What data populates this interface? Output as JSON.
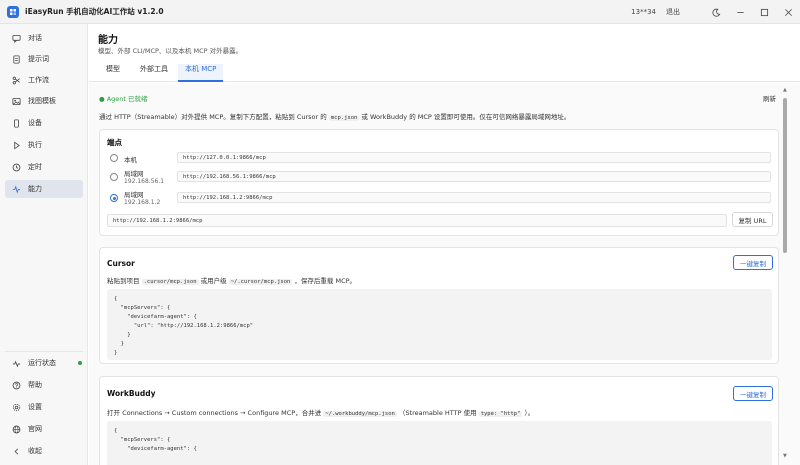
{
  "app": {
    "title": "iEasyRun 手机自动化AI工作站 v1.2.0",
    "user": "13**34",
    "logout": "退出"
  },
  "sidebar": {
    "items": [
      {
        "label": "对话",
        "icon": "chat-icon"
      },
      {
        "label": "提示词",
        "icon": "document-icon"
      },
      {
        "label": "工作流",
        "icon": "workflow-icon"
      },
      {
        "label": "找图模板",
        "icon": "image-icon"
      },
      {
        "label": "设备",
        "icon": "phone-icon"
      },
      {
        "label": "执行",
        "icon": "play-icon"
      },
      {
        "label": "定时",
        "icon": "clock-icon"
      },
      {
        "label": "能力",
        "icon": "capability-icon"
      }
    ],
    "bottom": [
      {
        "label": "运行状态",
        "icon": "pulse-icon"
      },
      {
        "label": "帮助",
        "icon": "help-icon"
      },
      {
        "label": "设置",
        "icon": "gear-icon"
      },
      {
        "label": "官网",
        "icon": "globe-icon"
      },
      {
        "label": "收起",
        "icon": "collapse-icon"
      }
    ]
  },
  "header": {
    "title": "能力",
    "subtitle": "模型、外部 CLI/MCP、以及本机 MCP 对外暴露。",
    "tabs": [
      {
        "label": "模型"
      },
      {
        "label": "外部工具"
      },
      {
        "label": "本机 MCP"
      }
    ]
  },
  "content": {
    "agent_status": "● Agent 已就绪",
    "refresh": "刷新",
    "desc_prefix": "通过 HTTP（Streamable）对外提供 MCP。复制下方配置，粘贴到 Cursor 的",
    "desc_code1": "mcp.json",
    "desc_mid": "或 WorkBuddy 的 MCP 设置即可使用。仅在可信网络暴露局域网地址。",
    "endpoints": {
      "title": "端点",
      "options": [
        {
          "label": "本机",
          "sub": "",
          "url": "http://127.0.0.1:9866/mcp"
        },
        {
          "label": "局域网",
          "sub": "192.168.56.1",
          "url": "http://192.168.56.1:9866/mcp"
        },
        {
          "label": "局域网",
          "sub": "192.168.1.2",
          "url": "http://192.168.1.2:9866/mcp"
        }
      ],
      "selected_url": "http://192.168.1.2:9866/mcp",
      "copy_url": "复制 URL"
    },
    "cursor": {
      "title": "Cursor",
      "copy": "一键复制",
      "desc_a": "粘贴到项目",
      "code_a": ".cursor/mcp.json",
      "desc_b": "或用户级",
      "code_b": "~/.cursor/mcp.json",
      "desc_c": "，保存后重载 MCP。",
      "code": "{\n  \"mcpServers\": {\n    \"devicefarm-agent\": {\n      \"url\": \"http://192.168.1.2:9866/mcp\"\n    }\n  }\n}"
    },
    "workbuddy": {
      "title": "WorkBuddy",
      "copy": "一键复制",
      "desc_a": "打开 Connections → Custom connections → Configure MCP，合并进",
      "code_a": "~/.workbuddy/mcp.json",
      "desc_b": "（Streamable HTTP 使用",
      "code_b": "type: \"http\"",
      "desc_c": "）。",
      "code": "{\n  \"mcpServers\": {\n    \"devicefarm-agent\": {"
    }
  }
}
